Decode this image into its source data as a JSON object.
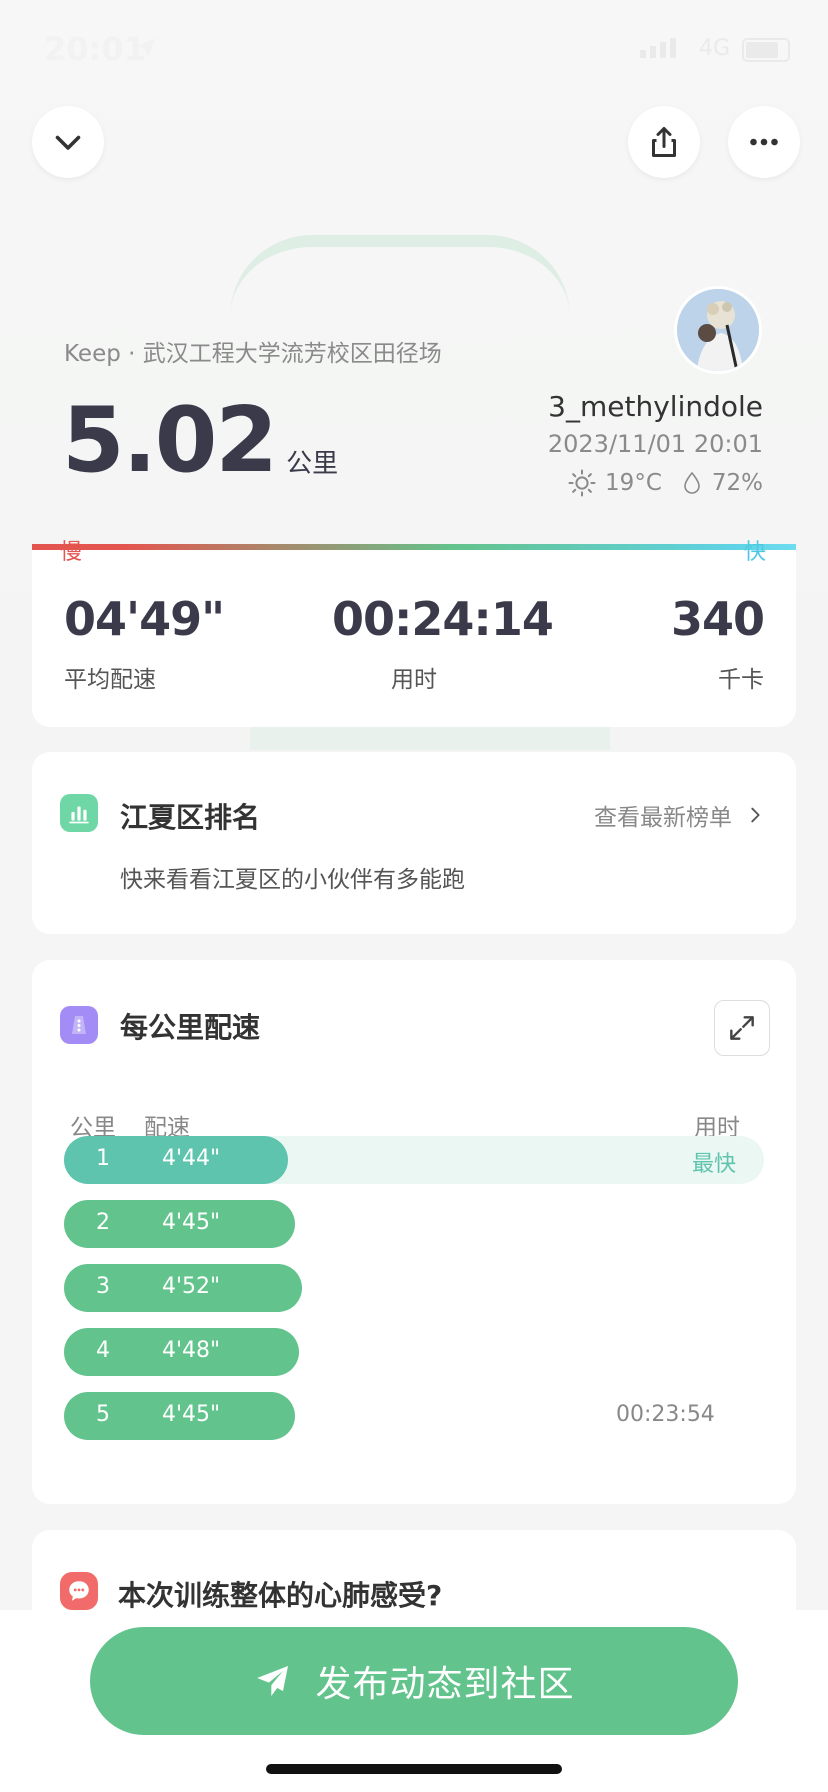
{
  "status_bar": {
    "time": "20:01",
    "network": "4G"
  },
  "header": {
    "location": "Keep · 武汉工程大学流芳校区田径场",
    "distance": "5.02",
    "distance_unit": "公里",
    "username": "3_methylindole",
    "datetime": "2023/11/01 20:01",
    "temperature": "19°C",
    "humidity": "72%"
  },
  "pace_scale": {
    "slow": "慢",
    "fast": "快"
  },
  "stats": [
    {
      "value": "04'49\"",
      "label": "平均配速"
    },
    {
      "value": "00:24:14",
      "label": "用时"
    },
    {
      "value": "340",
      "label": "千卡"
    }
  ],
  "ranking": {
    "title": "江夏区排名",
    "link": "查看最新榜单",
    "description": "快来看看江夏区的小伙伴有多能跑"
  },
  "splits": {
    "title": "每公里配速",
    "col_km": "公里",
    "col_pace": "配速",
    "col_time": "用时",
    "fastest_tag": "最快",
    "total_time": "00:23:54",
    "rows": [
      {
        "km": "1",
        "pace": "4'44\"",
        "fill": 0.32,
        "fastest": true
      },
      {
        "km": "2",
        "pace": "4'45\"",
        "fill": 0.33
      },
      {
        "km": "3",
        "pace": "4'52\"",
        "fill": 0.34
      },
      {
        "km": "4",
        "pace": "4'48\"",
        "fill": 0.335
      },
      {
        "km": "5",
        "pace": "4'45\"",
        "fill": 0.33
      }
    ]
  },
  "feedback": {
    "title": "本次训练整体的心肺感受?"
  },
  "publish_button": {
    "label": "发布动态到社区"
  },
  "colors": {
    "accent": "#62c48c",
    "fastest": "#5fc4ad",
    "slow": "#e4554f",
    "fast": "#4fc9e0"
  },
  "icons": [
    "location-arrow-icon",
    "chevron-down-icon",
    "share-icon",
    "more-icon",
    "sun-icon",
    "droplet-icon",
    "bar-chart-icon",
    "chevron-right-icon",
    "pace-icon",
    "expand-icon",
    "chat-icon",
    "send-icon"
  ]
}
